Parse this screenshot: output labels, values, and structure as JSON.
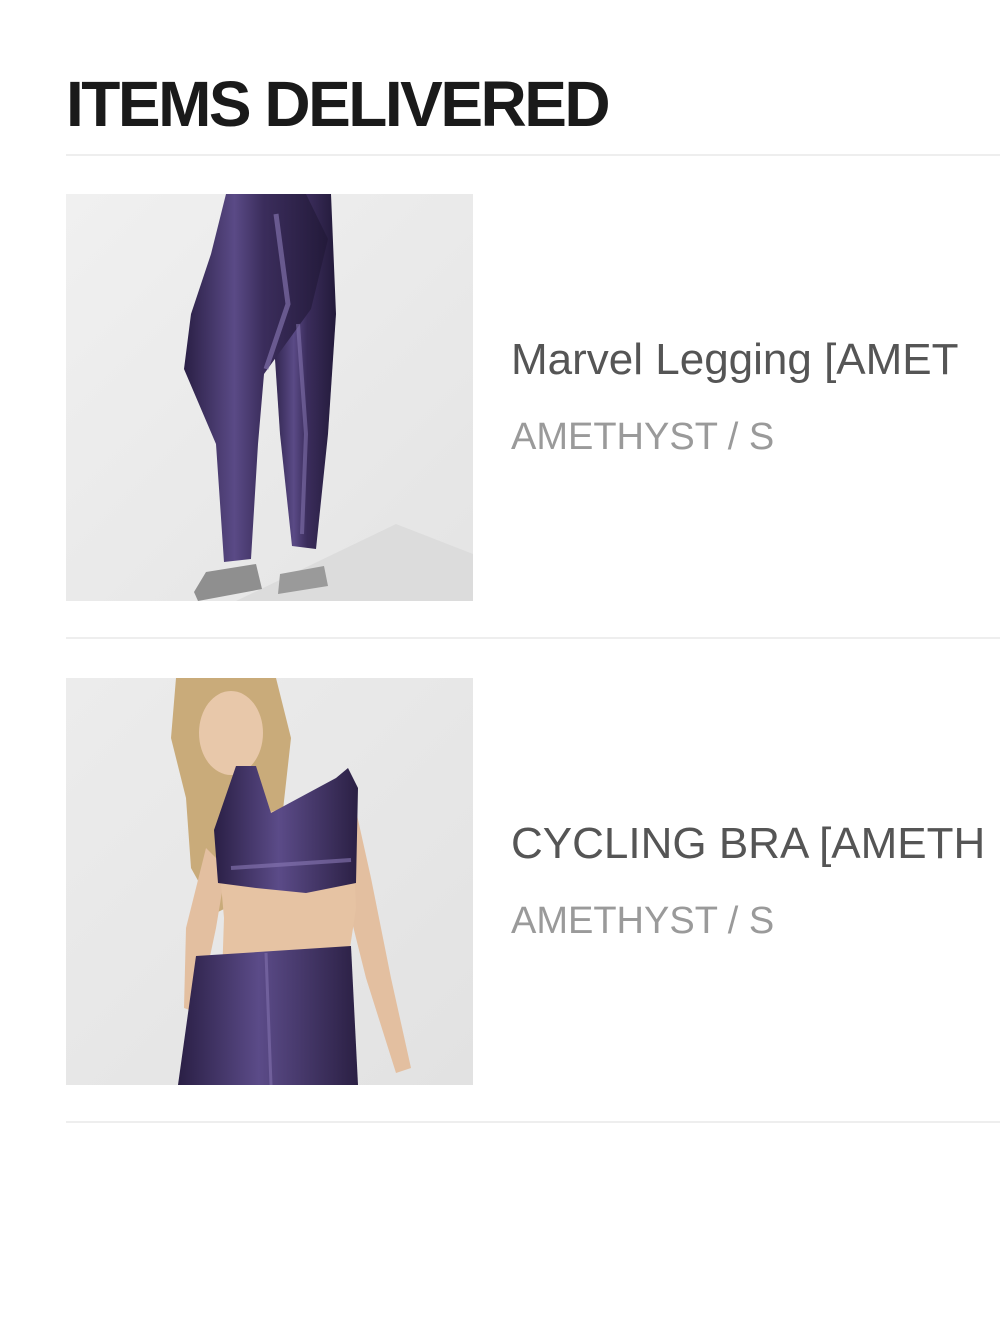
{
  "section": {
    "title": "ITEMS DELIVERED"
  },
  "items": [
    {
      "name": "Marvel Legging [AMET",
      "variant": "AMETHYST / S",
      "image": "leggings-product-photo"
    },
    {
      "name": "CYCLING BRA [AMETH",
      "variant": "AMETHYST / S",
      "image": "sports-bra-model-photo"
    }
  ],
  "colors": {
    "title": "#1a1a1a",
    "item_name": "#555555",
    "variant": "#9a9a9a",
    "divider": "#eeeeee",
    "amethyst": "#3b2d5c"
  }
}
